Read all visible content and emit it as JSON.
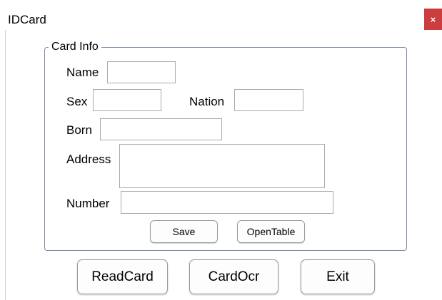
{
  "window": {
    "title": "IDCard",
    "close_glyph": "×"
  },
  "card_info": {
    "legend": "Card Info",
    "name_label": "Name",
    "name_value": "",
    "sex_label": "Sex",
    "sex_value": "",
    "nation_label": "Nation",
    "nation_value": "",
    "born_label": "Born",
    "born_value": "",
    "address_label": "Address",
    "address_value": "",
    "number_label": "Number",
    "number_value": "",
    "save_label": "Save",
    "open_table_label": "OpenTable"
  },
  "actions": {
    "read_card_label": "ReadCard",
    "card_ocr_label": "CardOcr",
    "exit_label": "Exit"
  },
  "colors": {
    "close_button": "#cc3d3d",
    "groupbox_border": "#7a8ba0"
  },
  "icons": {
    "close": "close-icon"
  }
}
